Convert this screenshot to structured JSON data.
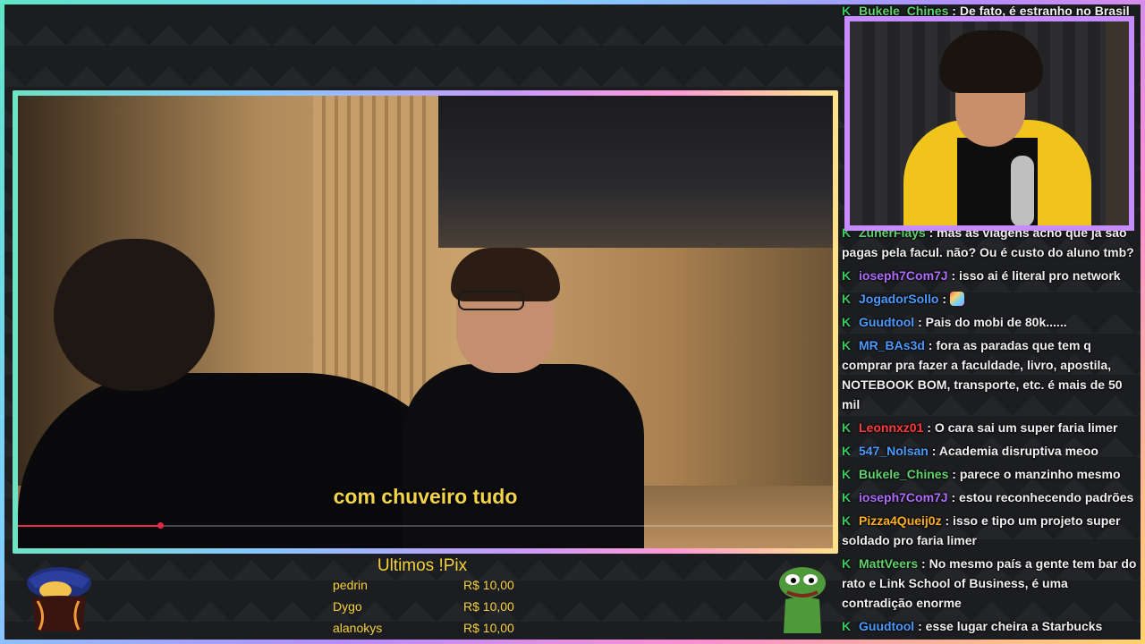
{
  "video": {
    "subtitle": "com chuveiro tudo",
    "progress": 0.175,
    "progress_color": "#e8294a"
  },
  "webcam": {
    "border_color": "#c58bff"
  },
  "chat": {
    "badge_icon": "K",
    "badge_color": "#38c95e",
    "messages": [
      {
        "user": "Bukele_Chines",
        "color": "#5fd36b",
        "text": "De fato, é estranho no Brasil"
      },
      {
        "user": "ZuherFlays",
        "color": "#5fd36b",
        "text": "mas as viagens acho que já são pagas pela facul. não? Ou é custo do aluno tmb?"
      },
      {
        "user": "ioseph7Com7J",
        "color": "#b06bff",
        "text": "isso ai é literal pro network"
      },
      {
        "user": "JogadorSollo",
        "color": "#4b9bff",
        "text": "",
        "emote": "rainbow-emote-icon"
      },
      {
        "user": "Guudtool",
        "color": "#4b9bff",
        "text": "Pais do mobi de 80k......"
      },
      {
        "user": "MR_BAs3d",
        "color": "#4b9bff",
        "text": "fora as paradas que tem q comprar pra fazer a faculdade, livro, apostila, NOTEBOOK BOM, transporte, etc. é mais de 50 mil"
      },
      {
        "user": "Leonnxz01",
        "color": "#ff3b3b",
        "text": "O cara sai um super faria limer"
      },
      {
        "user": "547_Nolsan",
        "color": "#4b9bff",
        "text": "Academia disruptiva meoo"
      },
      {
        "user": "Bukele_Chines",
        "color": "#5fd36b",
        "text": "parece o manzinho mesmo"
      },
      {
        "user": "ioseph7Com7J",
        "color": "#b06bff",
        "text": "estou reconhecendo padrões"
      },
      {
        "user": "Pizza4Queij0z",
        "color": "#ffb020",
        "text": "isso e tipo um projeto super soldado pro faria limer"
      },
      {
        "user": "MattVeers",
        "color": "#5fd36b",
        "text": "No mesmo país a gente tem bar do rato e Link School of Business, é uma contradição enorme"
      },
      {
        "user": "Guudtool",
        "color": "#4b9bff",
        "text": "esse lugar cheira a Starbucks"
      }
    ]
  },
  "pix": {
    "title": "Ultimos !Pix",
    "entries": [
      {
        "name": "pedrin",
        "amount": "R$ 10,00"
      },
      {
        "name": "Dygo",
        "amount": "R$ 10,00"
      },
      {
        "name": "alanokys",
        "amount": "R$ 10,00"
      }
    ]
  },
  "mascots": {
    "left": "caped-mascot-icon",
    "right": "pepe-frog-icon"
  }
}
